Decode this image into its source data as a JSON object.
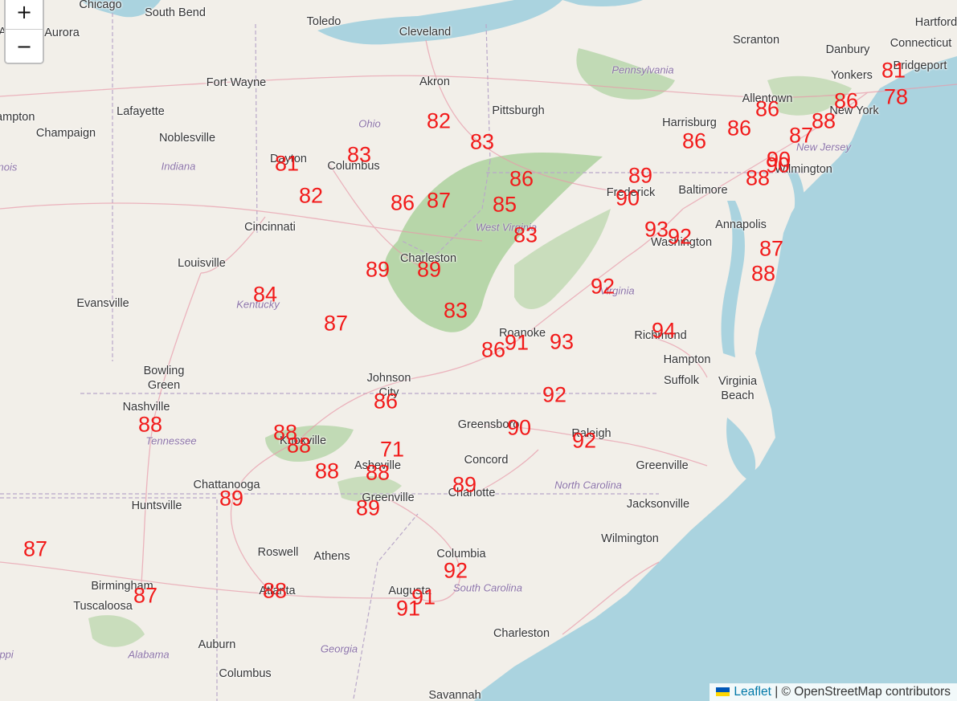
{
  "map": {
    "zoom_in_label": "+",
    "zoom_out_label": "−",
    "attribution": {
      "leaflet_link": "Leaflet",
      "separator": " | © ",
      "osm_text": "OpenStreetMap contributors",
      "flag_colors": [
        "#0057b7",
        "#ffd700"
      ]
    },
    "colors": {
      "land": "#f2efe9",
      "water": "#aad3df",
      "forest": "#add19e",
      "roads": "#e89aa9",
      "temperature_text": "#f21a1a"
    },
    "cities": [
      {
        "name": "Chicago"
      },
      {
        "name": "South Bend"
      },
      {
        "name": "Aurora"
      },
      {
        "name": "Toledo"
      },
      {
        "name": "Cleveland"
      },
      {
        "name": "Scranton"
      },
      {
        "name": "Danbury"
      },
      {
        "name": "Hartford"
      },
      {
        "name": "Connecticut"
      },
      {
        "name": "Fort Wayne"
      },
      {
        "name": "Akron"
      },
      {
        "name": "Bridgeport"
      },
      {
        "name": "Yonkers"
      },
      {
        "name": "Lafayette"
      },
      {
        "name": "Pittsburgh"
      },
      {
        "name": "Allentown"
      },
      {
        "name": "New York"
      },
      {
        "name": "Champaign"
      },
      {
        "name": "Harrisburg"
      },
      {
        "name": "Noblesville"
      },
      {
        "name": "Dayton"
      },
      {
        "name": "Columbus"
      },
      {
        "name": "Wilmington"
      },
      {
        "name": "Frederick"
      },
      {
        "name": "Baltimore"
      },
      {
        "name": "Cincinnati"
      },
      {
        "name": "Annapolis"
      },
      {
        "name": "Washington"
      },
      {
        "name": "Louisville"
      },
      {
        "name": "Charleston"
      },
      {
        "name": "Evansville"
      },
      {
        "name": "Roanoke"
      },
      {
        "name": "Richmond"
      },
      {
        "name": "Hampton"
      },
      {
        "name": "Suffolk"
      },
      {
        "name": "Virginia Beach"
      },
      {
        "name": "Bowling Green"
      },
      {
        "name": "Johnson City"
      },
      {
        "name": "Nashville"
      },
      {
        "name": "Greensboro"
      },
      {
        "name": "Raleigh"
      },
      {
        "name": "Knoxville"
      },
      {
        "name": "Asheville"
      },
      {
        "name": "Concord"
      },
      {
        "name": "Greenville"
      },
      {
        "name": "Chattanooga"
      },
      {
        "name": "Huntsville"
      },
      {
        "name": "Charlotte"
      },
      {
        "name": "Greenville"
      },
      {
        "name": "Jacksonville"
      },
      {
        "name": "Wilmington"
      },
      {
        "name": "Roswell"
      },
      {
        "name": "Athens"
      },
      {
        "name": "Columbia"
      },
      {
        "name": "Birmingham"
      },
      {
        "name": "Atlanta"
      },
      {
        "name": "Tuscaloosa"
      },
      {
        "name": "Augusta"
      },
      {
        "name": "Charleston"
      },
      {
        "name": "Auburn"
      },
      {
        "name": "Columbus"
      },
      {
        "name": "Savannah"
      },
      {
        "name": "Hampton"
      },
      {
        "name": "Aurora"
      }
    ],
    "states": [
      {
        "name": "Ohio"
      },
      {
        "name": "Pennsylvania"
      },
      {
        "name": "Indiana"
      },
      {
        "name": "New Jersey"
      },
      {
        "name": "West Virginia"
      },
      {
        "name": "Kentucky"
      },
      {
        "name": "Virginia"
      },
      {
        "name": "Tennessee"
      },
      {
        "name": "North Carolina"
      },
      {
        "name": "South Carolina"
      },
      {
        "name": "Georgia"
      },
      {
        "name": "Alabama"
      },
      {
        "name": "Illinois"
      },
      {
        "name": "Mississippi"
      }
    ],
    "temperatures": [
      "81",
      "78",
      "86",
      "86",
      "86",
      "86",
      "87",
      "88",
      "90",
      "90",
      "88",
      "89",
      "90",
      "93",
      "92",
      "87",
      "88",
      "82",
      "83",
      "83",
      "86",
      "81",
      "82",
      "86",
      "87",
      "85",
      "83",
      "89",
      "89",
      "84",
      "87",
      "83",
      "92",
      "94",
      "86",
      "91",
      "93",
      "92",
      "86",
      "90",
      "92",
      "88",
      "88",
      "88",
      "71",
      "88",
      "88",
      "89",
      "89",
      "89",
      "92",
      "87",
      "87",
      "88",
      "91",
      "91"
    ]
  }
}
